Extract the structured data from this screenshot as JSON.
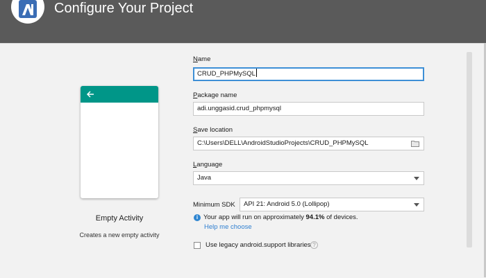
{
  "header": {
    "title": "Configure Your Project",
    "logo_icon": "android-studio-logo-icon"
  },
  "template": {
    "name": "Empty Activity",
    "description": "Creates a new empty activity",
    "accent": "#009688"
  },
  "form": {
    "name": {
      "label_u": "N",
      "label_rest": "ame",
      "value": "CRUD_PHPMySQL"
    },
    "package": {
      "label_u": "P",
      "label_rest": "ackage name",
      "value": "adi.unggasid.crud_phpmysql"
    },
    "save_location": {
      "label_u": "S",
      "label_rest": "ave location",
      "value": "C:\\Users\\DELL\\AndroidStudioProjects\\CRUD_PHPMySQL"
    },
    "language": {
      "label_u": "L",
      "label_rest": "anguage",
      "value": "Java"
    },
    "min_sdk": {
      "label": "Minimum SDK",
      "value": "API 21: Android 5.0 (Lollipop)"
    },
    "info": {
      "prefix": "Your app will run on approximately ",
      "percent": "94.1%",
      "suffix": " of devices."
    },
    "help_link": "Help me choose",
    "legacy_checkbox": {
      "label": "Use legacy android.support libraries",
      "checked": false
    }
  }
}
